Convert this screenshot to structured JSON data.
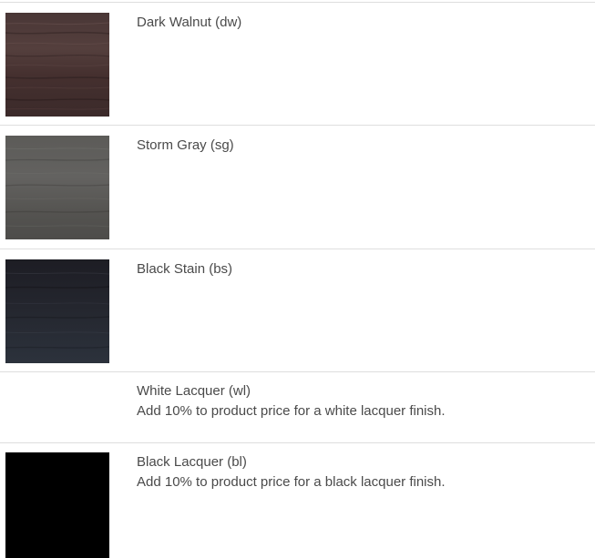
{
  "finishes": [
    {
      "name": "Dark Walnut (dw)",
      "description": "",
      "swatch": "dark-walnut-swatch",
      "color": "#4d3a38"
    },
    {
      "name": "Storm Gray (sg)",
      "description": "",
      "swatch": "storm-gray-swatch",
      "color": "#5a5957"
    },
    {
      "name": "Black Stain (bs)",
      "description": "",
      "swatch": "black-stain-swatch",
      "color": "#252933"
    },
    {
      "name": "White Lacquer (wl)",
      "description": "Add 10% to product price for a white lacquer finish.",
      "swatch": "",
      "color": "#ffffff"
    },
    {
      "name": "Black Lacquer (bl)",
      "description": "Add 10% to product price for a black lacquer finish.",
      "swatch": "black-lacquer-swatch",
      "color": "#000000"
    }
  ]
}
